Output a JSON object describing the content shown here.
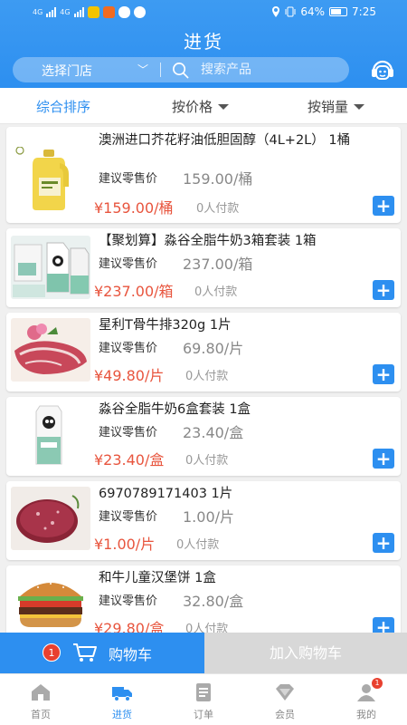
{
  "status_bar": {
    "battery": "64%",
    "time": "7:25",
    "network_tag_1": "4G",
    "network_tag_2": "4G"
  },
  "header": {
    "title": "进货",
    "store_select": "选择门店",
    "search_placeholder": "搜索产品"
  },
  "sort": {
    "items": [
      {
        "label": "综合排序",
        "active": true
      },
      {
        "label": "按价格"
      },
      {
        "label": "按销量"
      }
    ]
  },
  "products": [
    {
      "name": "澳洲进口芥花籽油低胆固醇（4L+2L） 1桶",
      "retail_label": "建议零售价",
      "retail_price": "159.00/桶",
      "price": "¥159.00/桶",
      "paid": "0人付款",
      "thumb": "oil-bottle"
    },
    {
      "name": "【聚划算】淼谷全脂牛奶3箱套装  1箱",
      "retail_label": "建议零售价",
      "retail_price": "237.00/箱",
      "price": "¥237.00/箱",
      "paid": "0人付款",
      "thumb": "milk-cartons"
    },
    {
      "name": "星利T骨牛排320g  1片",
      "retail_label": "建议零售价",
      "retail_price": "69.80/片",
      "price": "¥49.80/片",
      "paid": "0人付款",
      "thumb": "steak"
    },
    {
      "name": "淼谷全脂牛奶6盒套装  1盒",
      "retail_label": "建议零售价",
      "retail_price": "23.40/盒",
      "price": "¥23.40/盒",
      "paid": "0人付款",
      "thumb": "milk-box"
    },
    {
      "name": "6970789171403  1片",
      "retail_label": "建议零售价",
      "retail_price": "1.00/片",
      "price": "¥1.00/片",
      "paid": "0人付款",
      "thumb": "burger-patty"
    },
    {
      "name": "和牛儿童汉堡饼  1盒",
      "retail_label": "建议零售价",
      "retail_price": "32.80/盒",
      "price": "¥29.80/盒",
      "paid": "0人付款",
      "thumb": "burger"
    }
  ],
  "cart": {
    "count": "1",
    "label": "购物车",
    "add_label": "加入购物车"
  },
  "tabbar": {
    "items": [
      {
        "label": "首页",
        "icon": "home-icon"
      },
      {
        "label": "进货",
        "icon": "truck-icon",
        "active": true
      },
      {
        "label": "订单",
        "icon": "order-icon"
      },
      {
        "label": "会员",
        "icon": "member-icon"
      },
      {
        "label": "我的",
        "icon": "profile-icon",
        "badge": "1"
      }
    ]
  },
  "colors": {
    "primary": "#2d8ff0",
    "price": "#e8553e",
    "badge": "#e8402f"
  }
}
